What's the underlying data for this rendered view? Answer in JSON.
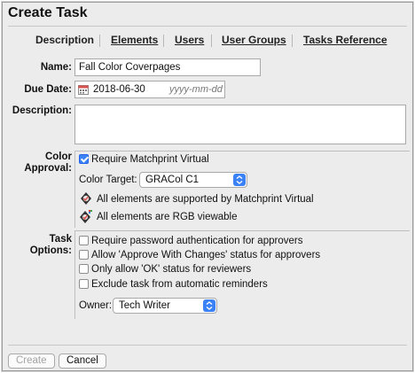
{
  "dialog": {
    "title": "Create Task"
  },
  "tabs": [
    {
      "label": "Description",
      "active": true
    },
    {
      "label": "Elements",
      "active": false
    },
    {
      "label": "Users",
      "active": false
    },
    {
      "label": "User Groups",
      "active": false
    },
    {
      "label": "Tasks Reference",
      "active": false
    }
  ],
  "form": {
    "name_label": "Name:",
    "name_value": "Fall Color Coverpages",
    "due_date_label": "Due Date:",
    "due_date_value": "2018-06-30",
    "due_date_placeholder": "yyyy-mm-dd",
    "description_label": "Description:",
    "description_value": ""
  },
  "color_approval": {
    "label_line1": "Color",
    "label_line2": "Approval:",
    "require_matchprint": {
      "label": "Require Matchprint Virtual",
      "checked": true
    },
    "color_target_label": "Color Target:",
    "color_target_value": "GRACol C1",
    "status_supported": "All elements are supported by Matchprint Virtual",
    "status_rgb": "All elements are RGB viewable"
  },
  "task_options": {
    "label_line1": "Task",
    "label_line2": "Options:",
    "options": [
      {
        "label": "Require password authentication for approvers",
        "checked": false
      },
      {
        "label": "Allow 'Approve With Changes' status for approvers",
        "checked": false
      },
      {
        "label": "Only allow 'OK' status for reviewers",
        "checked": false
      },
      {
        "label": "Exclude task from automatic reminders",
        "checked": false
      }
    ],
    "owner_label": "Owner:",
    "owner_value": "Tech Writer"
  },
  "buttons": {
    "create": "Create",
    "cancel": "Cancel"
  },
  "colors": {
    "accent": "#3b82f6",
    "dialog_bg": "#ececec"
  }
}
